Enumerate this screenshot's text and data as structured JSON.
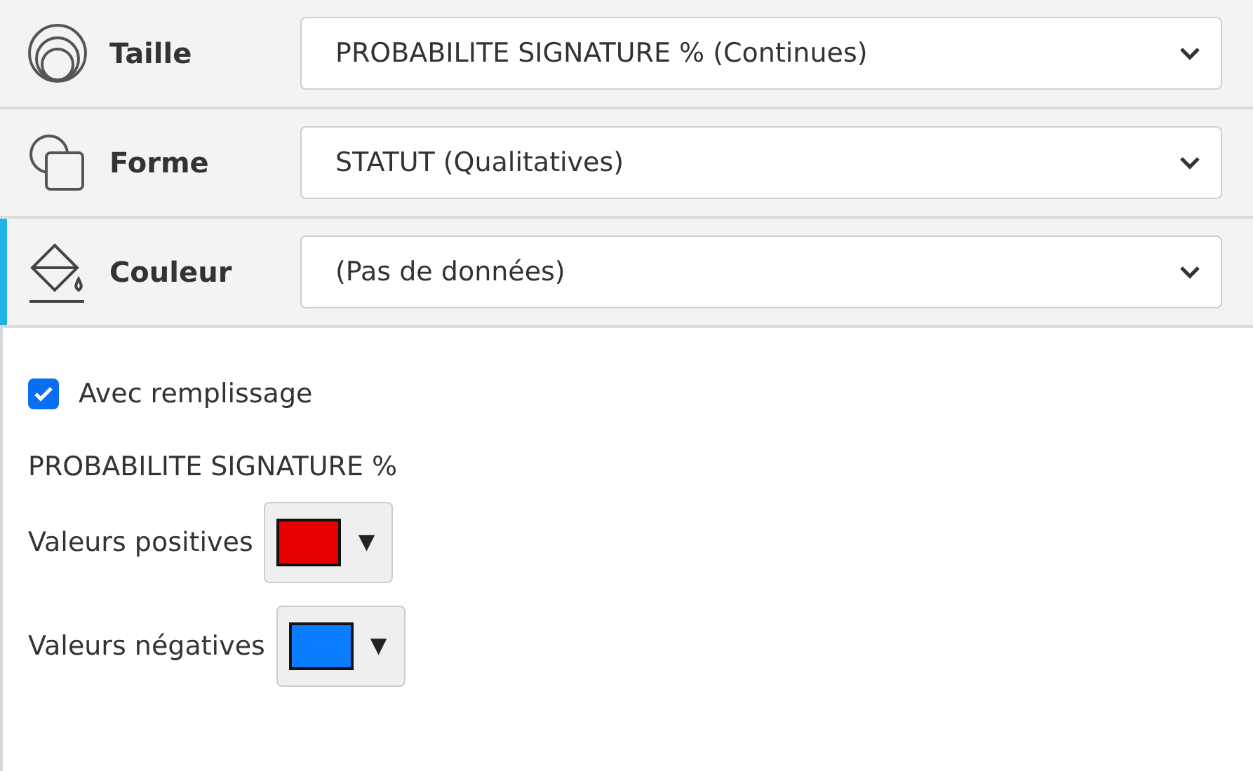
{
  "mappings": [
    {
      "kind": "size",
      "label": "Taille",
      "value": "PROBABILITE SIGNATURE % (Continues)",
      "selected": false
    },
    {
      "kind": "shape",
      "label": "Forme",
      "value": "STATUT (Qualitatives)",
      "selected": false
    },
    {
      "kind": "color",
      "label": "Couleur",
      "value": "(Pas de données)",
      "selected": true
    }
  ],
  "fill": {
    "label": "Avec remplissage",
    "checked": true
  },
  "section_title": "PROBABILITE SIGNATURE %",
  "color_pickers": [
    {
      "label": "Valeurs positives",
      "color": "#e60000",
      "caret": "▼"
    },
    {
      "label": "Valeurs négatives",
      "color": "#0a7cff",
      "caret": "▼"
    }
  ]
}
